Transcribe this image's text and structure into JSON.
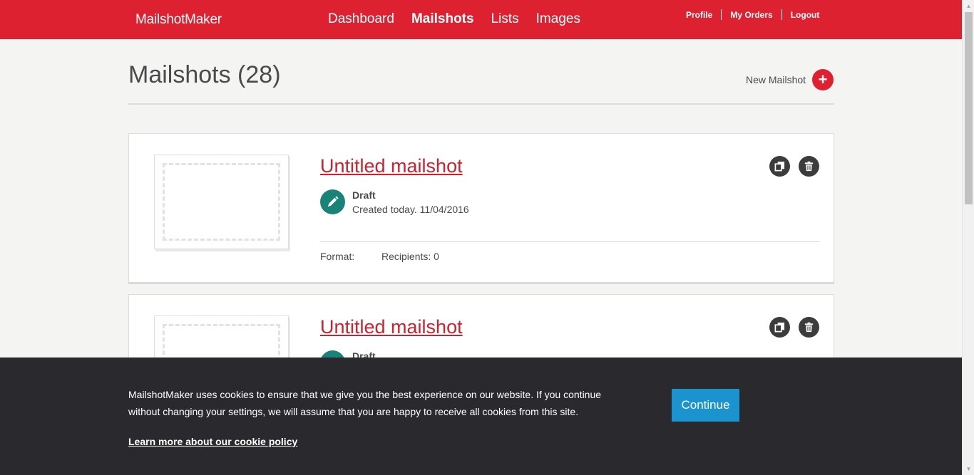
{
  "header": {
    "logo": "MailshotMaker",
    "nav": [
      "Dashboard",
      "Mailshots",
      "Lists",
      "Images"
    ],
    "active_nav": "Mailshots",
    "user_links": [
      "Profile",
      "My Orders",
      "Logout"
    ]
  },
  "page": {
    "title": "Mailshots (28)",
    "new_button_label": "New Mailshot"
  },
  "mailshots": [
    {
      "title": "Untitled mailshot",
      "status": "Draft",
      "created": "Created today. 11/04/2016",
      "format_label": "Format:",
      "recipients": "Recipients: 0"
    },
    {
      "title": "Untitled mailshot",
      "status": "Draft",
      "created": "",
      "format_label": "",
      "recipients": ""
    }
  ],
  "cookie_banner": {
    "text": "MailshotMaker uses cookies to ensure that we give you the best experience on our website. If you continue without changing your settings, we will assume that you are happy to receive all cookies from this site.",
    "link": "Learn more about our cookie policy",
    "button": "Continue"
  },
  "colors": {
    "brand_red": "#de2130",
    "draft_teal": "#1a8378",
    "continue_blue": "#1b93cf",
    "banner_dark": "#2a2a2e"
  },
  "icons": [
    "plus-icon",
    "pencil-icon",
    "duplicate-icon",
    "trash-icon"
  ]
}
